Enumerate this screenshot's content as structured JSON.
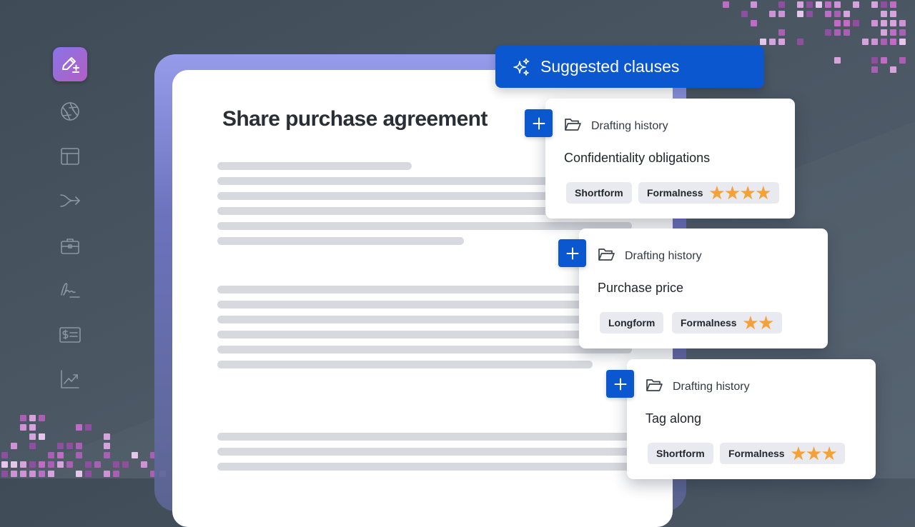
{
  "document": {
    "title": "Share purchase agreement"
  },
  "sidebar": {
    "logo_icon": "pen-plus-icon",
    "items": [
      {
        "icon": "aperture-icon"
      },
      {
        "icon": "layout-icon"
      },
      {
        "icon": "merge-arrow-icon"
      },
      {
        "icon": "briefcase-icon"
      },
      {
        "icon": "signature-icon"
      },
      {
        "icon": "invoice-dollar-icon"
      },
      {
        "icon": "trend-chart-icon"
      }
    ]
  },
  "suggestions": {
    "header": "Suggested clauses",
    "clauses": [
      {
        "source": "Drafting history",
        "title": "Confidentiality obligations",
        "length_tag": "Shortform",
        "formalness_label": "Formalness",
        "formalness_rating": 4
      },
      {
        "source": "Drafting history",
        "title": "Purchase price",
        "length_tag": "Longform",
        "formalness_label": "Formalness",
        "formalness_rating": 2
      },
      {
        "source": "Drafting history",
        "title": "Tag along",
        "length_tag": "Shortform",
        "formalness_label": "Formalness",
        "formalness_rating": 3
      }
    ]
  },
  "colors": {
    "accent": "#0b57d0",
    "star": "#f5a13a",
    "background": "#4a5662",
    "logo_gradient_start": "#8a74e6",
    "logo_gradient_end": "#b25fc4"
  }
}
